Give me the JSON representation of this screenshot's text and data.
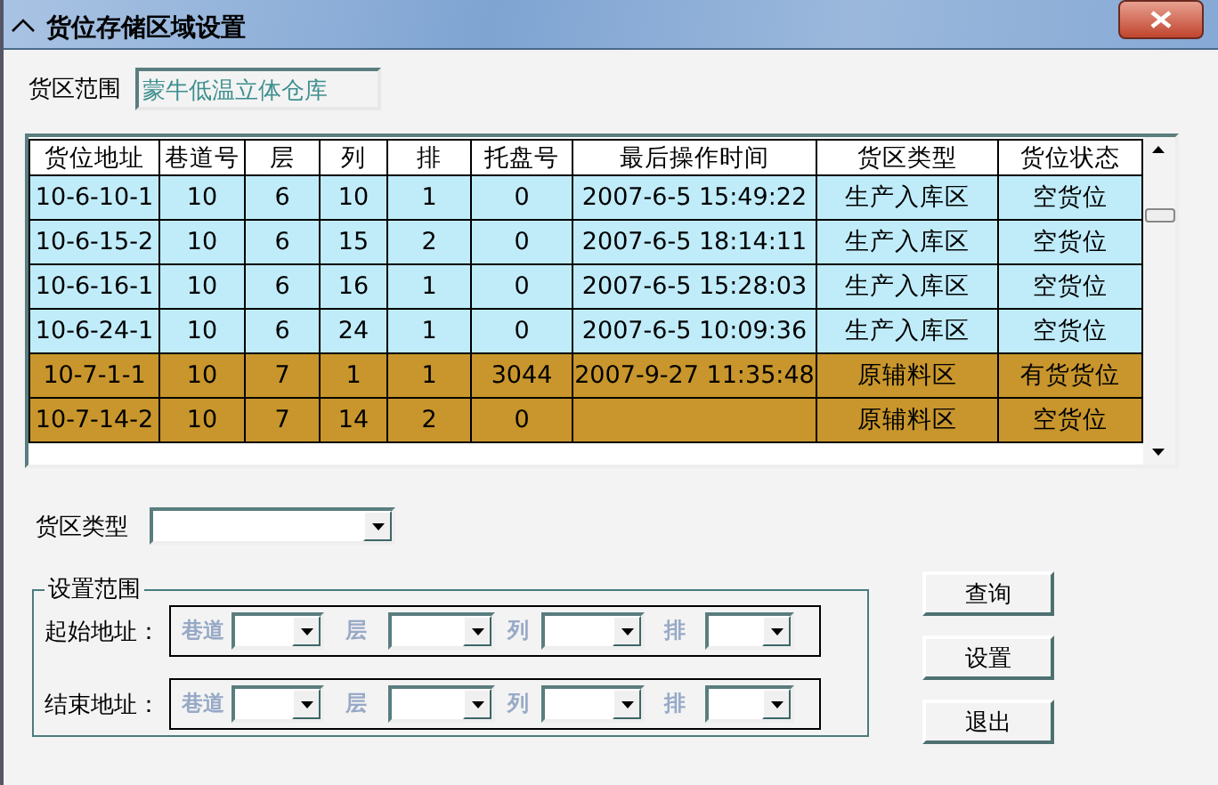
{
  "window": {
    "title": "货位存储区域设置"
  },
  "warehouse": {
    "label": "货区范围",
    "value": "蒙牛低温立体仓库"
  },
  "table": {
    "columns": [
      "货位地址",
      "巷道号",
      "层",
      "列",
      "排",
      "托盘号",
      "最后操作时间",
      "货区类型",
      "货位状态"
    ],
    "rows": [
      {
        "color": "#c0ecfa",
        "cells": [
          "10-6-10-1",
          "10",
          "6",
          "10",
          "1",
          "0",
          "2007-6-5 15:49:22",
          "生产入库区",
          "空货位"
        ]
      },
      {
        "color": "#c0ecfa",
        "cells": [
          "10-6-15-2",
          "10",
          "6",
          "15",
          "2",
          "0",
          "2007-6-5 18:14:11",
          "生产入库区",
          "空货位"
        ]
      },
      {
        "color": "#c0ecfa",
        "cells": [
          "10-6-16-1",
          "10",
          "6",
          "16",
          "1",
          "0",
          "2007-6-5 15:28:03",
          "生产入库区",
          "空货位"
        ]
      },
      {
        "color": "#c0ecfa",
        "cells": [
          "10-6-24-1",
          "10",
          "6",
          "24",
          "1",
          "0",
          "2007-6-5 10:09:36",
          "生产入库区",
          "空货位"
        ]
      },
      {
        "color": "#c8962c",
        "cells": [
          "10-7-1-1",
          "10",
          "7",
          "1",
          "1",
          "3044",
          "2007-9-27 11:35:48",
          "原辅料区",
          "有货货位"
        ]
      },
      {
        "color": "#c8962c",
        "cells": [
          "10-7-14-2",
          "10",
          "7",
          "14",
          "2",
          "0",
          "",
          "原辅料区",
          "空货位"
        ]
      }
    ]
  },
  "zone_type": {
    "label": "货区类型"
  },
  "range": {
    "legend": "设置范围",
    "rows": [
      {
        "label": "起始地址：",
        "fields": [
          "巷道",
          "层",
          "列",
          "排"
        ]
      },
      {
        "label": "结束地址：",
        "fields": [
          "巷道",
          "层",
          "列",
          "排"
        ]
      }
    ]
  },
  "buttons": [
    "查询",
    "设置",
    "退出"
  ]
}
